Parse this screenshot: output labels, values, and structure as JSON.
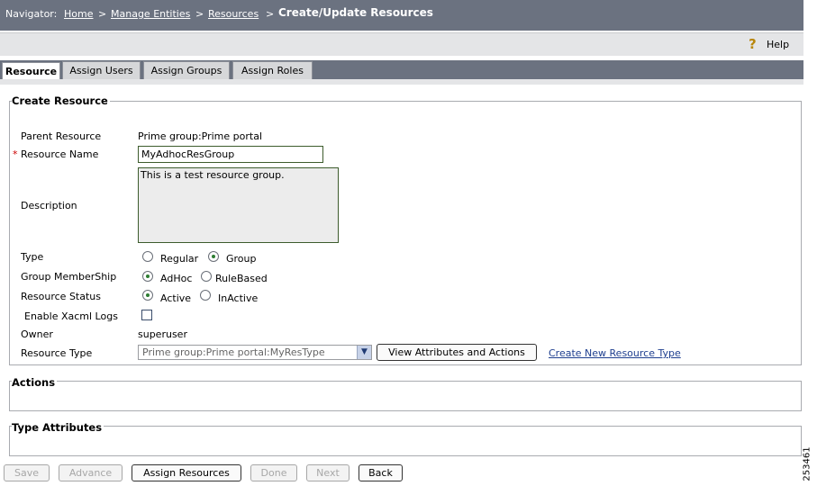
{
  "navigator": {
    "prefix": "Navigator:",
    "crumbs": [
      "Home",
      "Manage Entities",
      "Resources"
    ],
    "separator": ">",
    "current": "Create/Update Resources"
  },
  "help": {
    "label": "Help",
    "icon": "help-question-icon"
  },
  "tabs": [
    {
      "label": "Resource",
      "active": true
    },
    {
      "label": "Assign Users",
      "active": false
    },
    {
      "label": "Assign Groups",
      "active": false
    },
    {
      "label": "Assign Roles",
      "active": false
    }
  ],
  "create_resource": {
    "legend": "Create Resource",
    "parent_label": "Parent Resource",
    "parent_value": "Prime group:Prime portal",
    "required_mark": "*",
    "name_label": "Resource Name",
    "name_value": "MyAdhocResGroup",
    "description_label": "Description",
    "description_value": "This is a test resource group.",
    "type_label": "Type",
    "type_options": {
      "regular": "Regular",
      "group": "Group",
      "selected": "Group"
    },
    "membership_label": "Group MemberShip",
    "membership_options": {
      "adhoc": "AdHoc",
      "rulebased": "RuleBased",
      "selected": "AdHoc"
    },
    "status_label": "Resource Status",
    "status_options": {
      "active": "Active",
      "inactive": "InActive",
      "selected": "Active"
    },
    "xacml_label": "Enable Xacml Logs",
    "xacml_checked": false,
    "owner_label": "Owner",
    "owner_value": "superuser",
    "restype_label": "Resource Type",
    "restype_value": "Prime group:Prime portal:MyResType",
    "view_attr_button": "View Attributes and Actions",
    "create_type_link": "Create New Resource Type"
  },
  "actions_legend": "Actions",
  "type_attributes_legend": "Type Attributes",
  "footer_buttons": [
    {
      "label": "Save",
      "enabled": false
    },
    {
      "label": "Advance",
      "enabled": false
    },
    {
      "label": "Assign Resources",
      "enabled": true
    },
    {
      "label": "Done",
      "enabled": false
    },
    {
      "label": "Next",
      "enabled": false
    },
    {
      "label": "Back",
      "enabled": true
    }
  ],
  "figure_id": "253461",
  "colors": {
    "header_bg": "#6b7280",
    "subbar_bg": "#e4e5e7",
    "link": "#1f3f8f",
    "required": "#cc0000"
  }
}
